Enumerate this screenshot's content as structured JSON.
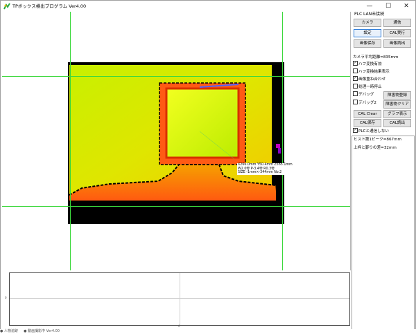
{
  "window": {
    "title": "TPボックス検出プログラム Ver4.00",
    "minimize_glyph": "—",
    "maximize_glyph": "☐",
    "close_glyph": "✕"
  },
  "overlay": {
    "line1": "X266.0mm Y50.4mm Z565.1mm",
    "line2": "W2.0零 P-3.4零 R0.3零",
    "line3": "SIZE -1mm×-344mm No.2"
  },
  "panel": {
    "plc_label": "PLC LAN未接続",
    "buttons": {
      "camera": "カメラ",
      "comm": "通信",
      "settings": "設定",
      "cal_exec": "CAL実行",
      "image_save": "画像保存",
      "image_load": "画像読出",
      "obstacle_register": "障害物登録",
      "obstacle_clear": "障害物クリア",
      "cal_clear": "CAL Clear",
      "graph_show": "グラフ表示",
      "cal_save": "CAL保存",
      "cal_load": "CAL読出"
    },
    "camera_distance": "カメラ平均距離=835mm",
    "checkboxes": {
      "hough_enable": {
        "label": "ハフ変換有効",
        "checked": true
      },
      "hough_result": {
        "label": "ハフ変換結果表示",
        "checked": false
      },
      "image_overlay": {
        "label": "画像重ね合わせ",
        "checked": true
      },
      "pause": {
        "label": "処理一時停止",
        "checked": false
      },
      "debug": {
        "label": "デバッグ",
        "checked": false
      },
      "debug2": {
        "label": "デバッグ2",
        "checked": false
      },
      "plc_no_judge": {
        "label": "PLCと通信しない",
        "checked": true
      }
    },
    "info_lines": {
      "hist_peak": "ヒスト第1ピーク=867mm",
      "top_bottom_diff": "上枠と罫りの差=32mm"
    }
  },
  "graph": {
    "y_label": "0",
    "x_label": "0"
  },
  "taskbar": {
    "text": "                                       ● 人物追跡 　  ● 動画撮影中 Ver4.00"
  }
}
